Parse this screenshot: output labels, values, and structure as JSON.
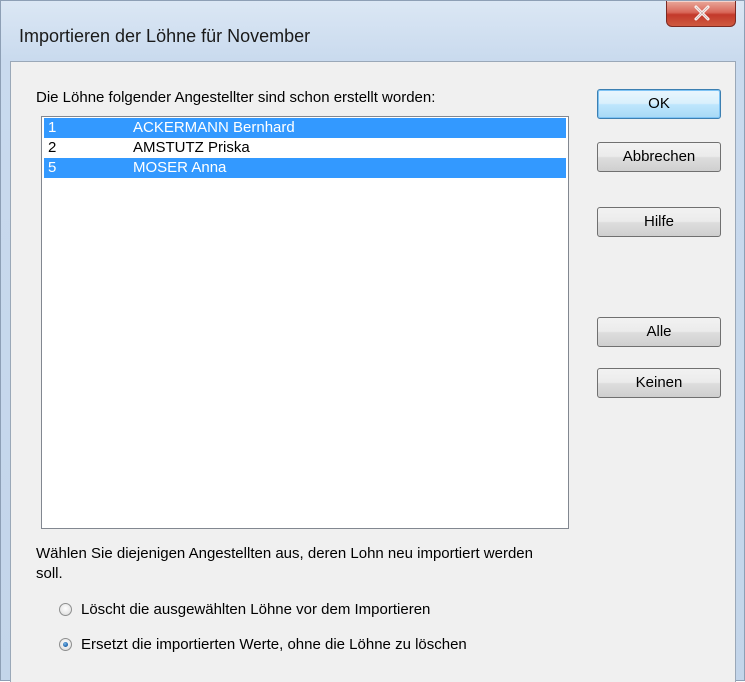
{
  "window": {
    "title": "Importieren der Löhne für November",
    "close_icon": "close-icon"
  },
  "list": {
    "label": "Die Löhne folgender Angestellter sind schon erstellt worden:",
    "rows": [
      {
        "num": "1",
        "name": "ACKERMANN Bernhard",
        "selected": true
      },
      {
        "num": "2",
        "name": "AMSTUTZ Priska",
        "selected": false
      },
      {
        "num": "5",
        "name": "MOSER Anna",
        "selected": true
      }
    ]
  },
  "buttons": {
    "ok": "OK",
    "cancel": "Abbrechen",
    "help": "Hilfe",
    "all": "Alle",
    "none": "Keinen"
  },
  "hint": "Wählen Sie diejenigen Angestellten aus, deren Lohn neu importiert werden soll.",
  "options": [
    {
      "label": "Löscht die ausgewählten Löhne vor dem Importieren",
      "checked": false
    },
    {
      "label": "Ersetzt die importierten Werte, ohne die Löhne zu löschen",
      "checked": true
    }
  ],
  "colors": {
    "selection": "#3399ff",
    "close_button": "#c3392a"
  }
}
